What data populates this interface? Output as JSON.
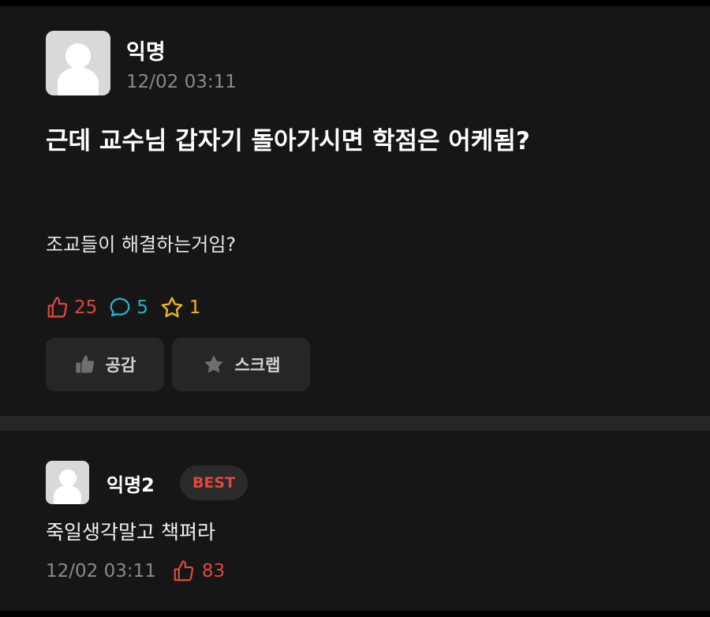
{
  "post": {
    "author": "익명",
    "time": "12/02 03:11",
    "title": "근데 교수님 갑자기 돌아가시면 학점은 어케됨?",
    "body": "조교들이 해결하는거임?",
    "stats": {
      "likes": "25",
      "comments": "5",
      "scraps": "1"
    },
    "buttons": {
      "like_label": "공감",
      "scrap_label": "스크랩"
    }
  },
  "comment": {
    "author": "익명2",
    "badge": "BEST",
    "text": "죽일생각말고 책펴라",
    "time": "12/02 03:11",
    "likes": "83"
  },
  "colors": {
    "like": "#e0473e",
    "comment": "#27b4c8",
    "scrap": "#f0b320",
    "background": "#161616",
    "button": "#262626"
  }
}
